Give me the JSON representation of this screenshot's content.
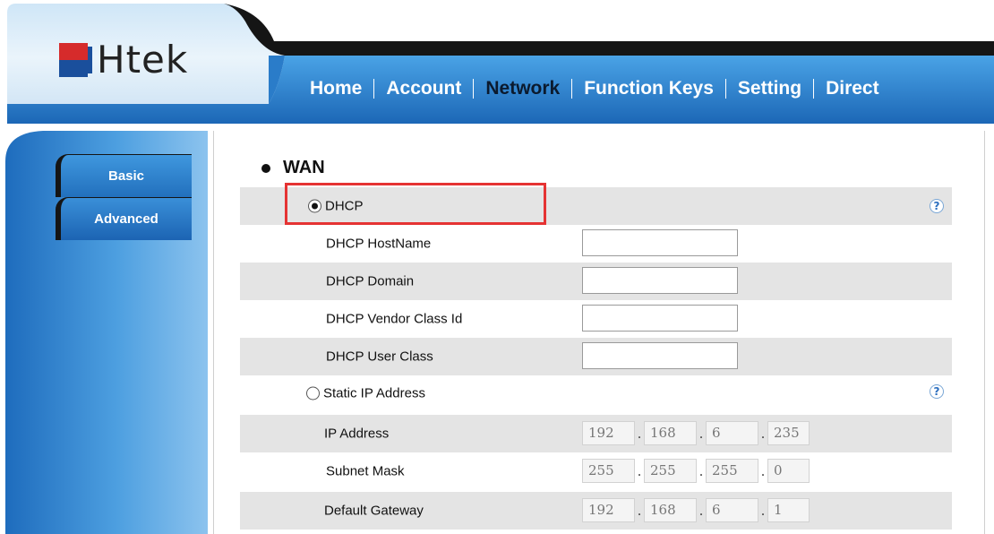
{
  "brand": {
    "logo_text": "Htek"
  },
  "nav": {
    "items": [
      {
        "label": "Home"
      },
      {
        "label": "Account"
      },
      {
        "label": "Network"
      },
      {
        "label": "Function Keys"
      },
      {
        "label": "Setting"
      },
      {
        "label": "Direct"
      }
    ],
    "active": "Network"
  },
  "sidebar": {
    "items": [
      {
        "label": "Basic"
      },
      {
        "label": "Advanced"
      }
    ]
  },
  "wan": {
    "title": "WAN",
    "dhcp": {
      "label": "DHCP",
      "selected": true,
      "hostname_label": "DHCP HostName",
      "hostname_value": "",
      "domain_label": "DHCP Domain",
      "domain_value": "",
      "vendor_class_label": "DHCP Vendor Class Id",
      "vendor_class_value": "",
      "user_class_label": "DHCP User Class",
      "user_class_value": ""
    },
    "static": {
      "label": "Static IP Address",
      "selected": false,
      "ip_label": "IP Address",
      "ip": [
        "192",
        "168",
        "6",
        "235"
      ],
      "mask_label": "Subnet Mask",
      "mask": [
        "255",
        "255",
        "255",
        "0"
      ],
      "gateway_label": "Default Gateway",
      "gateway": [
        "192",
        "168",
        "6",
        "1"
      ]
    },
    "help_glyph": "?"
  },
  "colors": {
    "header_blue": "#2a7cc9",
    "header_dark": "#151515",
    "sidebar_blue": "#2a7cc9",
    "row_gray": "#e4e4e4",
    "highlight_red": "#e53333"
  },
  "icons": {
    "help": "help-icon",
    "bullet": "bullet-icon",
    "radio": "radio-icon"
  }
}
